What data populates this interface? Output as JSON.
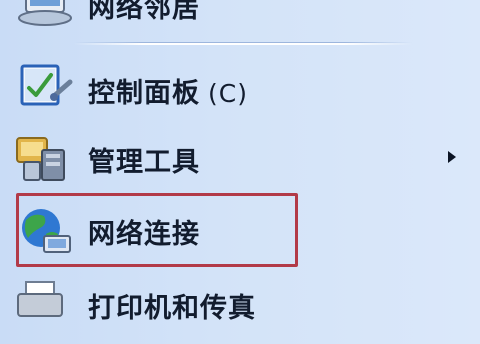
{
  "menu": {
    "items": [
      {
        "label": "网络邻居",
        "accel": "",
        "icon": "network-places-icon",
        "submenu": false
      },
      {
        "label": "控制面板",
        "accel": "(C)",
        "icon": "control-panel-icon",
        "submenu": false
      },
      {
        "label": "管理工具",
        "accel": "",
        "icon": "admin-tools-icon",
        "submenu": true
      },
      {
        "label": "网络连接",
        "accel": "",
        "icon": "network-connections-icon",
        "submenu": false,
        "highlighted": true
      },
      {
        "label": "打印机和传真",
        "accel": "",
        "icon": "printer-fax-icon",
        "submenu": false
      }
    ],
    "submenu_arrow_icon": "submenu-arrow-icon",
    "highlight_color": "#b23a48",
    "background_color": "#d3e3f8"
  }
}
